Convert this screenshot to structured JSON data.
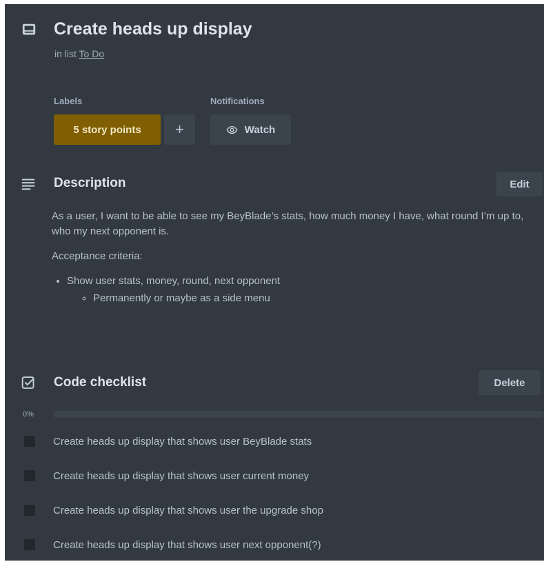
{
  "card": {
    "title": "Create heads up display",
    "in_list_prefix": "in list",
    "list_name": "To Do",
    "icon": "card-icon"
  },
  "labels": {
    "heading": "Labels",
    "items": [
      {
        "text": "5 story points",
        "color": "#7f5f01"
      }
    ],
    "add_label": "+"
  },
  "notifications": {
    "heading": "Notifications",
    "watch_label": "Watch",
    "icon": "eye-icon"
  },
  "description": {
    "heading": "Description",
    "edit_label": "Edit",
    "icon": "description-lines-icon",
    "paragraph": "As a user, I want to be able to see my BeyBlade’s stats, how much money I have, what round I’m up to, who my next opponent is.",
    "criteria_heading": "Acceptance criteria:",
    "bullet": "Show user stats, money, round, next opponent",
    "sub_bullet": "Permanently or maybe as a side menu"
  },
  "checklist": {
    "heading": "Code checklist",
    "delete_label": "Delete",
    "icon": "checkbox-icon",
    "progress_text": "0%",
    "progress": 0,
    "items": [
      {
        "text": "Create heads up display that shows user BeyBlade stats",
        "checked": false
      },
      {
        "text": "Create heads up display that shows user current money",
        "checked": false
      },
      {
        "text": "Create heads up display that shows user the upgrade shop",
        "checked": false
      },
      {
        "text": "Create heads up display that shows user next opponent(?)",
        "checked": false
      }
    ]
  },
  "colors": {
    "background": "#323940",
    "label_yellow": "#7f5f01",
    "button": "#3b444c"
  }
}
